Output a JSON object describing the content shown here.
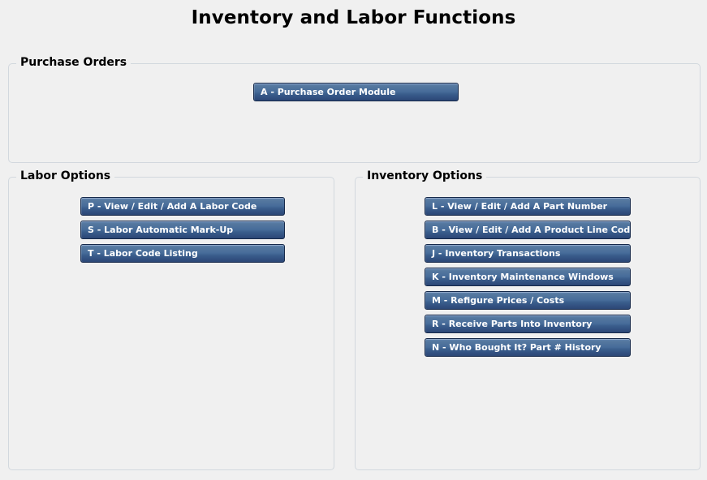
{
  "page": {
    "title": "Inventory and Labor Functions",
    "background_color": "#f0f0f0",
    "button_border_color": "#16294a",
    "button_gradient_top": "#6486b4",
    "button_gradient_bottom": "#2b4775",
    "button_text_color": "#ffffff",
    "group_border_color": "#d2d8de"
  },
  "purchase_orders": {
    "legend": "Purchase Orders",
    "buttons": [
      {
        "label": "A - Purchase Order Module"
      }
    ]
  },
  "labor_options": {
    "legend": "Labor Options",
    "buttons": [
      {
        "label": "P - View / Edit / Add A Labor Code"
      },
      {
        "label": "S - Labor Automatic Mark-Up"
      },
      {
        "label": "T - Labor Code Listing"
      }
    ]
  },
  "inventory_options": {
    "legend": "Inventory Options",
    "buttons": [
      {
        "label": "L - View / Edit / Add A Part Number"
      },
      {
        "label": "B - View / Edit / Add A Product Line Code"
      },
      {
        "label": "J - Inventory Transactions"
      },
      {
        "label": "K - Inventory Maintenance Windows"
      },
      {
        "label": "M - Refigure Prices / Costs"
      },
      {
        "label": "R - Receive Parts Into Inventory"
      },
      {
        "label": "N - Who Bought It? Part # History"
      }
    ]
  }
}
